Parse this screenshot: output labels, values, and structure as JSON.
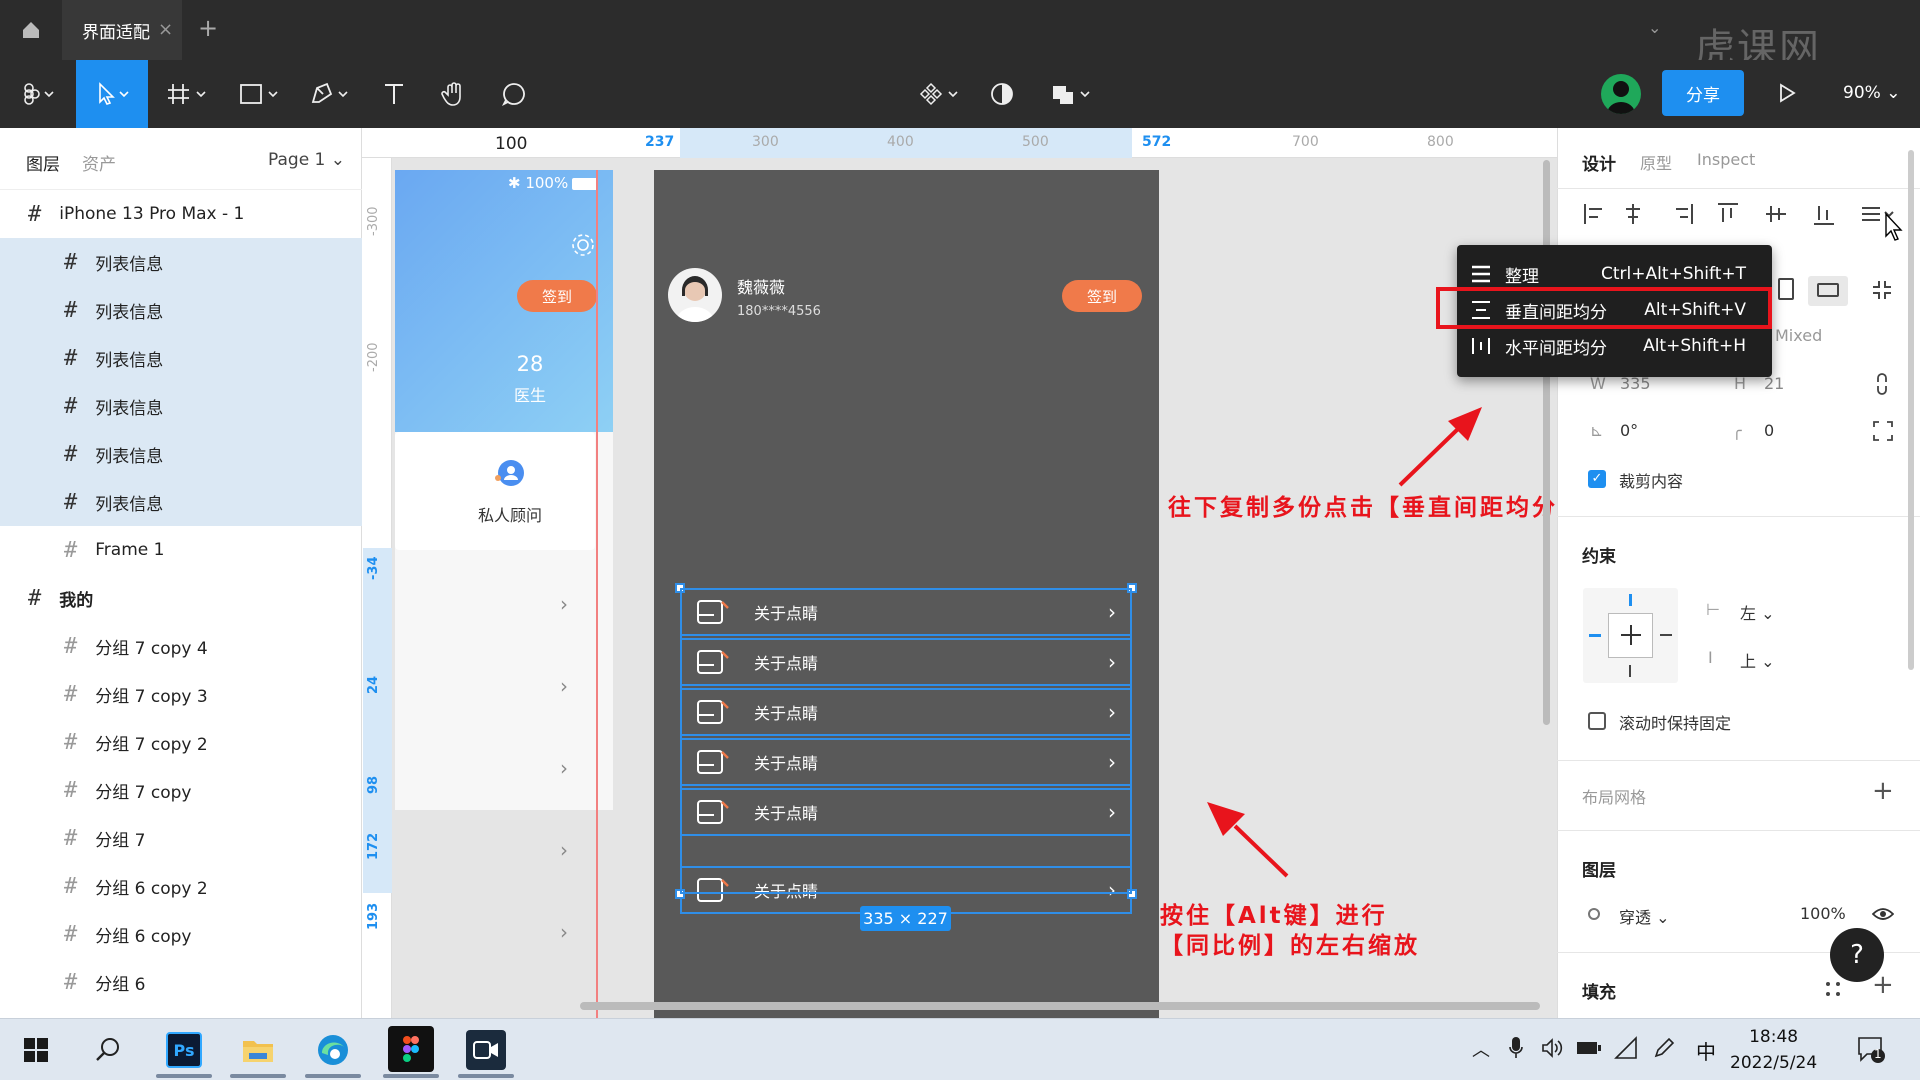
{
  "titlebar": {
    "tab_label": "界面适配",
    "tab_close": "×",
    "new_tab": "+",
    "chevron": "⌄",
    "watermark": "虎课网"
  },
  "toolbar": {
    "share": "分享",
    "zoom": "90%"
  },
  "left_panel": {
    "tabs": [
      "图层",
      "资产"
    ],
    "page": "Page 1",
    "layers": [
      {
        "label": "iPhone 13 Pro Max - 1",
        "selected": false,
        "indent": 0
      },
      {
        "label": "列表信息",
        "selected": true,
        "indent": 1
      },
      {
        "label": "列表信息",
        "selected": true,
        "indent": 1
      },
      {
        "label": "列表信息",
        "selected": true,
        "indent": 1
      },
      {
        "label": "列表信息",
        "selected": true,
        "indent": 1
      },
      {
        "label": "列表信息",
        "selected": true,
        "indent": 1
      },
      {
        "label": "列表信息",
        "selected": true,
        "indent": 1
      },
      {
        "label": "Frame 1",
        "selected": false,
        "indent": 1
      },
      {
        "label": "我的",
        "selected": false,
        "indent": 0
      },
      {
        "label": "分组 7 copy 4",
        "selected": false,
        "indent": 1
      },
      {
        "label": "分组 7 copy 3",
        "selected": false,
        "indent": 1
      },
      {
        "label": "分组 7 copy 2",
        "selected": false,
        "indent": 1
      },
      {
        "label": "分组 7 copy",
        "selected": false,
        "indent": 1
      },
      {
        "label": "分组 7",
        "selected": false,
        "indent": 1
      },
      {
        "label": "分组 6 copy 2",
        "selected": false,
        "indent": 1
      },
      {
        "label": "分组 6 copy",
        "selected": false,
        "indent": 1
      },
      {
        "label": "分组 6",
        "selected": false,
        "indent": 1
      }
    ]
  },
  "ruler": {
    "top": [
      "100",
      "237",
      "300",
      "400",
      "500",
      "572",
      "700",
      "800"
    ],
    "left": [
      "-300",
      "-200",
      "-34",
      "24",
      "98",
      "172",
      "193"
    ]
  },
  "frame_a": {
    "battery": "100%",
    "sign": "签到",
    "count": "28",
    "count_label": "医生",
    "advisor": "私人顾问"
  },
  "frame_b": {
    "user_name": "魏薇薇",
    "phone": "180****4556",
    "sign": "签到",
    "items": [
      "关于点睛",
      "关于点睛",
      "关于点睛",
      "关于点睛",
      "关于点睛",
      "关于点睛"
    ],
    "dimension": "335 × 227"
  },
  "annotations": {
    "top": "往下复制多份点击【垂直间距均分】",
    "bottom_line1": "按住【Alt键】进行",
    "bottom_line2": "【同比例】的左右缩放"
  },
  "context_menu": [
    {
      "label": "整理",
      "shortcut": "Ctrl+Alt+Shift+T",
      "icon": "tidy-icon"
    },
    {
      "label": "垂直间距均分",
      "shortcut": "Alt+Shift+V",
      "icon": "distribute-vertical-icon"
    },
    {
      "label": "水平间距均分",
      "shortcut": "Alt+Shift+H",
      "icon": "distribute-horizontal-icon"
    }
  ],
  "right_panel": {
    "tabs": [
      "设计",
      "原型",
      "Inspect"
    ],
    "mixed": "Mixed",
    "w_label": "W",
    "w_value": "335",
    "h_label": "H",
    "h_value": "21",
    "rotation": "0°",
    "radius": "0",
    "clip_content": "裁剪内容",
    "constraints_title": "约束",
    "constraint_h": "左",
    "constraint_v": "上",
    "fix_scroll": "滚动时保持固定",
    "layout_grid": "布局网格",
    "layer_title": "图层",
    "blend": "穿透",
    "opacity": "100%",
    "fill_title": "填充",
    "help": "?"
  },
  "taskbar": {
    "ps": "Ps",
    "ime": "中",
    "time": "18:48",
    "date": "2022/5/24",
    "notif": "1"
  }
}
